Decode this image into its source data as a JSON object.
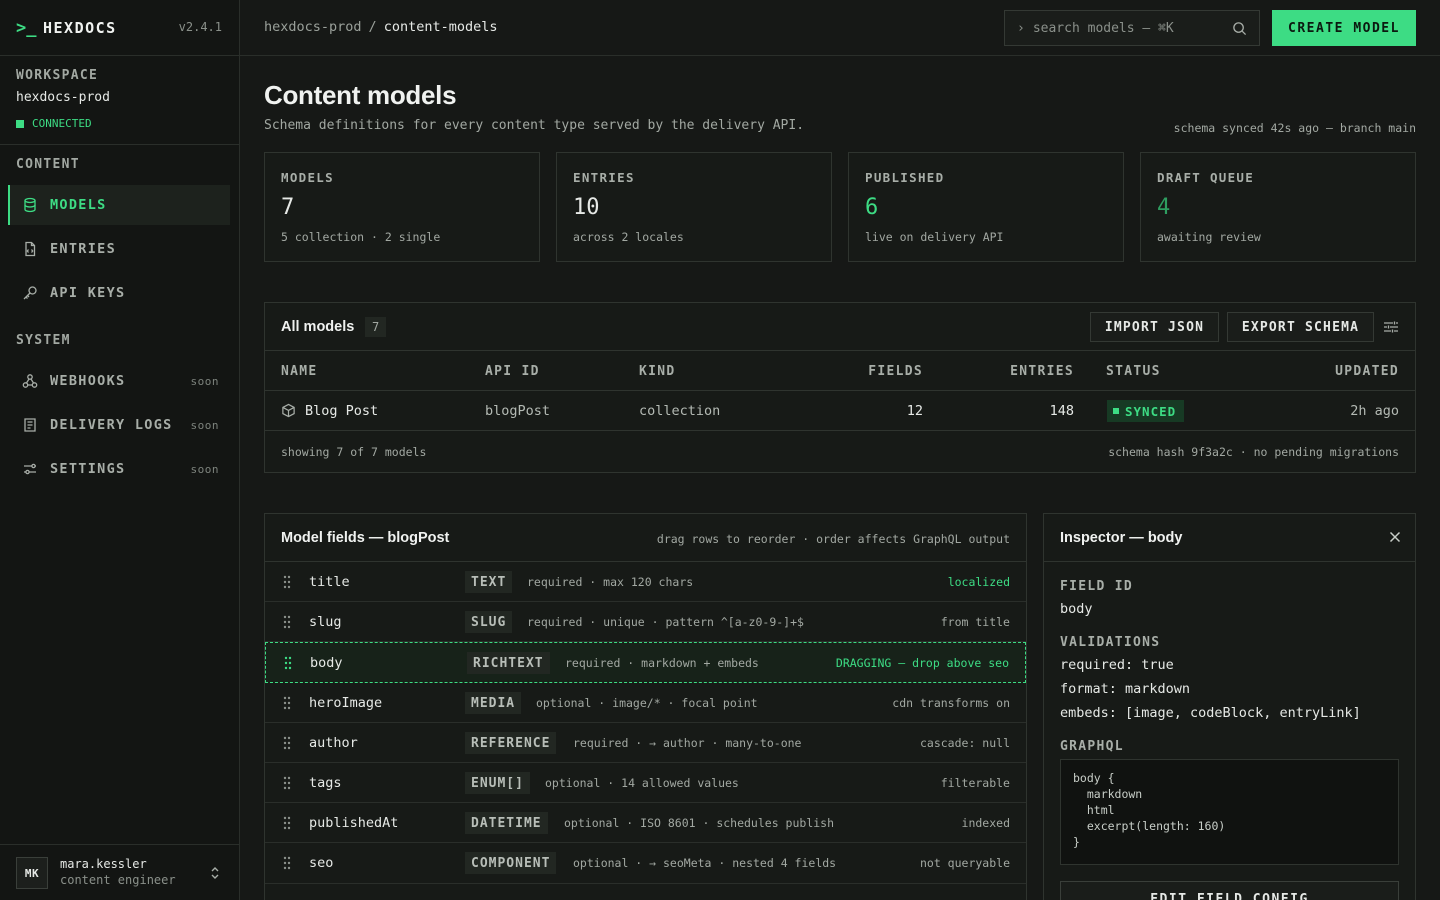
{
  "brand": {
    "glyph": ">_",
    "name": "HEXDOCS",
    "version": "v2.4.1"
  },
  "workspace": {
    "label": "WORKSPACE",
    "name": "hexdocs-prod",
    "status": "CONNECTED"
  },
  "sidebar": {
    "content_label": "CONTENT",
    "system_label": "SYSTEM",
    "content_items": [
      {
        "label": "MODELS",
        "icon": "database-icon",
        "active": true
      },
      {
        "label": "ENTRIES",
        "icon": "file-icon"
      },
      {
        "label": "API KEYS",
        "icon": "key-icon"
      }
    ],
    "system_items": [
      {
        "label": "WEBHOOKS",
        "icon": "webhook-icon",
        "badge": "soon"
      },
      {
        "label": "DELIVERY LOGS",
        "icon": "logs-icon",
        "badge": "soon"
      },
      {
        "label": "SETTINGS",
        "icon": "settings-icon",
        "badge": "soon"
      }
    ]
  },
  "user": {
    "initials": "MK",
    "name": "mara.kessler",
    "role": "content engineer"
  },
  "topbar": {
    "breadcrumb": [
      "hexdocs-prod",
      "content-models"
    ],
    "search_placeholder": "search models — ⌘K",
    "create_label": "CREATE MODEL"
  },
  "page": {
    "title": "Content models",
    "subtitle": "Schema definitions for every content type served by the delivery API.",
    "sync_note": "schema synced 42s ago — branch main"
  },
  "stats": [
    {
      "label": "MODELS",
      "value": "7",
      "sub": "5 collection · 2 single"
    },
    {
      "label": "ENTRIES",
      "value": "10",
      "sub": "across 2 locales"
    },
    {
      "label": "PUBLISHED",
      "value": "6",
      "sub": "live on delivery API"
    },
    {
      "label": "DRAFT QUEUE",
      "value": "4",
      "sub": "awaiting review"
    }
  ],
  "models_table": {
    "title": "All models",
    "count": "7",
    "import_label": "IMPORT JSON",
    "export_label": "EXPORT SCHEMA",
    "columns": [
      "NAME",
      "API ID",
      "KIND",
      "FIELDS",
      "ENTRIES",
      "STATUS",
      "UPDATED"
    ],
    "rows": [
      {
        "name": "Blog Post",
        "api_id": "blogPost",
        "kind": "collection",
        "fields": "12",
        "entries": "148",
        "status": "SYNCED",
        "updated": "2h ago"
      }
    ],
    "footer_left": "showing 7 of 7 models",
    "footer_right": "schema hash 9f3a2c · no pending migrations"
  },
  "fields_panel": {
    "title": "Model fields — blogPost",
    "hint": "drag rows to reorder · order affects GraphQL output",
    "rows": [
      {
        "name": "title",
        "type": "TEXT",
        "desc": "required · max 120 chars",
        "note": "localized",
        "note_green": true
      },
      {
        "name": "slug",
        "type": "SLUG",
        "desc": "required · unique · pattern ^[a-z0-9-]+$",
        "note": "from title"
      },
      {
        "name": "body",
        "type": "RICHTEXT",
        "desc": "required · markdown + embeds",
        "note": "DRAGGING — drop above seo",
        "note_green": true,
        "dragging": true
      },
      {
        "name": "heroImage",
        "type": "MEDIA",
        "desc": "optional · image/* · focal point",
        "note": "cdn transforms on"
      },
      {
        "name": "author",
        "type": "REFERENCE",
        "desc": "required · → author · many-to-one",
        "note": "cascade: null"
      },
      {
        "name": "tags",
        "type": "ENUM[]",
        "desc": "optional · 14 allowed values",
        "note": "filterable"
      },
      {
        "name": "publishedAt",
        "type": "DATETIME",
        "desc": "optional · ISO 8601 · schedules publish",
        "note": "indexed"
      },
      {
        "name": "seo",
        "type": "COMPONENT",
        "desc": "optional · → seoMeta · nested 4 fields",
        "note": "not queryable"
      }
    ]
  },
  "inspector": {
    "title": "Inspector — body",
    "field_id_label": "FIELD ID",
    "field_id": "body",
    "validations_label": "VALIDATIONS",
    "validations": [
      "required: true",
      "format: markdown",
      "embeds: [image, codeBlock, entryLink]"
    ],
    "graphql_label": "GRAPHQL",
    "graphql_lines": [
      "body {",
      "  markdown",
      "  html",
      "  excerpt(length: 160)",
      "}"
    ],
    "edit_label": "EDIT FIELD CONFIG"
  },
  "colors": {
    "accent": "#3ddc84",
    "background": "#161816",
    "panel": "#171a17",
    "border": "#2f342f"
  }
}
